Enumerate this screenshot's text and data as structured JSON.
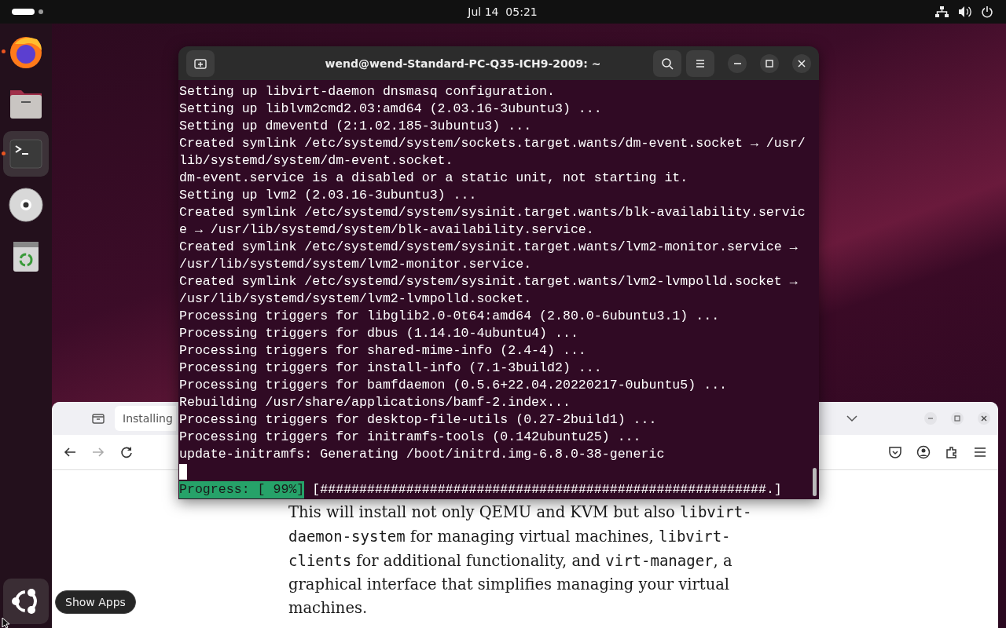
{
  "top_bar": {
    "clock": "Jul 14  05:21"
  },
  "dock": {
    "apps": [
      {
        "kind": "firefox",
        "running": true,
        "active": false
      },
      {
        "kind": "files",
        "running": false,
        "active": false
      },
      {
        "kind": "terminal",
        "running": true,
        "active": true
      },
      {
        "kind": "disc",
        "running": false,
        "active": false
      },
      {
        "kind": "trash",
        "running": false,
        "active": false
      }
    ],
    "show_apps": {
      "tooltip": "Show Apps"
    }
  },
  "browser": {
    "tabs": [
      {
        "label": "Installing",
        "selected": true
      }
    ],
    "forward_disabled": true,
    "paragraph": [
      {
        "kind": "text",
        "text": "This will install not only QEMU and KVM but also "
      },
      {
        "kind": "code",
        "text": "libvirt-daemon-system"
      },
      {
        "kind": "text",
        "text": " for managing virtual machines, "
      },
      {
        "kind": "code",
        "text": "libvirt-clients"
      },
      {
        "kind": "text",
        "text": " for additional functionality, and "
      },
      {
        "kind": "code",
        "text": "virt-manager"
      },
      {
        "kind": "text",
        "text": ", a graphical interface that simplifies managing your virtual machines."
      }
    ]
  },
  "terminal": {
    "title": "wend@wend-Standard-PC-Q35-ICH9-2009: ~",
    "lines": [
      "Setting up libvirt-daemon dnsmasq configuration.",
      "Setting up liblvm2cmd2.03:amd64 (2.03.16-3ubuntu3) ...",
      "Setting up dmeventd (2:1.02.185-3ubuntu3) ...",
      "Created symlink /etc/systemd/system/sockets.target.wants/dm-event.socket → /usr/",
      "lib/systemd/system/dm-event.socket.",
      "dm-event.service is a disabled or a static unit, not starting it.",
      "Setting up lvm2 (2.03.16-3ubuntu3) ...",
      "Created symlink /etc/systemd/system/sysinit.target.wants/blk-availability.servic",
      "e → /usr/lib/systemd/system/blk-availability.service.",
      "Created symlink /etc/systemd/system/sysinit.target.wants/lvm2-monitor.service →",
      "/usr/lib/systemd/system/lvm2-monitor.service.",
      "Created symlink /etc/systemd/system/sysinit.target.wants/lvm2-lvmpolld.socket →",
      "/usr/lib/systemd/system/lvm2-lvmpolld.socket.",
      "Processing triggers for libglib2.0-0t64:amd64 (2.80.0-6ubuntu3.1) ...",
      "Processing triggers for dbus (1.14.10-4ubuntu4) ...",
      "Processing triggers for shared-mime-info (2.4-4) ...",
      "Processing triggers for install-info (7.1-3build2) ...",
      "Processing triggers for bamfdaemon (0.5.6+22.04.20220217-0ubuntu5) ...",
      "Rebuilding /usr/share/applications/bamf-2.index...",
      "Processing triggers for desktop-file-utils (0.27-2build1) ...",
      "Processing triggers for initramfs-tools (0.142ubuntu25) ...",
      "update-initramfs: Generating /boot/initrd.img-6.8.0-38-generic"
    ],
    "progress": {
      "label": "Progress: [ 99%]",
      "bar": "[#########################################################.]"
    }
  }
}
